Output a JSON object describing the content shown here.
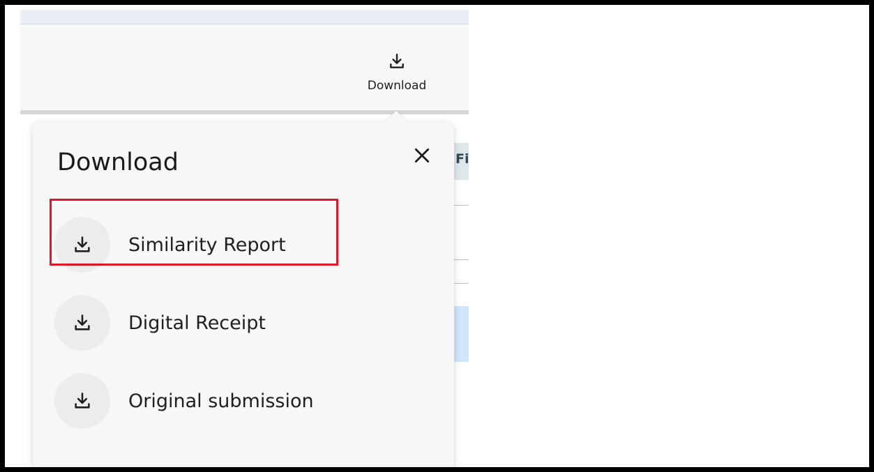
{
  "toolbar": {
    "download_icon": "download-icon",
    "download_label": "Download"
  },
  "table": {
    "header_partial": "Fi"
  },
  "popover": {
    "title": "Download",
    "close_icon": "close-icon",
    "items": [
      {
        "label": "Similarity Report",
        "icon": "download-icon"
      },
      {
        "label": "Digital Receipt",
        "icon": "download-icon"
      },
      {
        "label": "Original submission",
        "icon": "download-icon"
      }
    ]
  },
  "colors": {
    "annotation": "#e0142c",
    "popover_bg": "#f7f7f7",
    "icon_circle": "#ececec"
  }
}
